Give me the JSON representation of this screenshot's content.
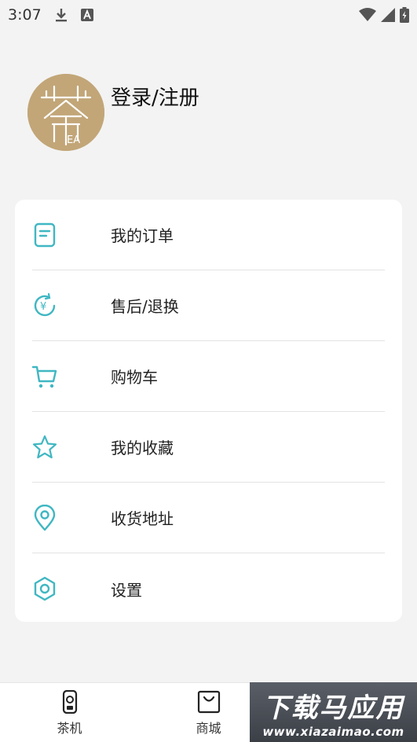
{
  "status_bar": {
    "time": "3:07",
    "icons": [
      "download-icon",
      "font-a-icon",
      "wifi-icon",
      "signal-icon",
      "battery-icon"
    ]
  },
  "profile": {
    "login_text": "登录/注册",
    "logo_text": "EA"
  },
  "menu": {
    "accent_color": "#3fb7c2",
    "items": [
      {
        "label": "我的订单",
        "icon": "order-icon"
      },
      {
        "label": "售后/退换",
        "icon": "refund-icon"
      },
      {
        "label": "购物车",
        "icon": "cart-icon"
      },
      {
        "label": "我的收藏",
        "icon": "star-icon"
      },
      {
        "label": "收货地址",
        "icon": "location-icon"
      },
      {
        "label": "设置",
        "icon": "settings-icon"
      }
    ]
  },
  "bottom_nav": {
    "items": [
      {
        "label": "茶机",
        "icon": "tea-machine-icon"
      },
      {
        "label": "商城",
        "icon": "shopping-bag-icon"
      }
    ]
  },
  "watermark": {
    "main": "下载马应用",
    "sub": "www.xiazaimao.com"
  }
}
